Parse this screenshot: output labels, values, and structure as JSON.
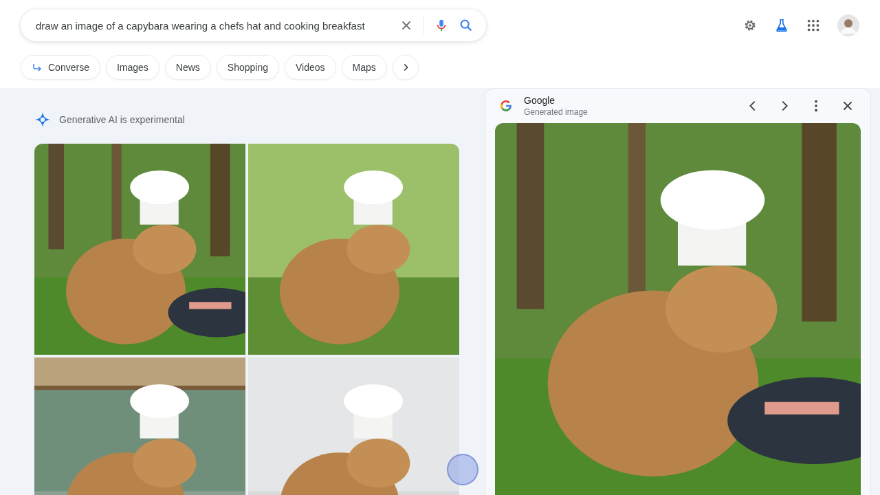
{
  "search": {
    "value": "draw an image of a capybara wearing a chefs hat and cooking breakfast"
  },
  "chips": [
    {
      "label": "Converse",
      "kind": "converse"
    },
    {
      "label": "Images",
      "kind": "plain"
    },
    {
      "label": "News",
      "kind": "plain"
    },
    {
      "label": "Shopping",
      "kind": "plain"
    },
    {
      "label": "Videos",
      "kind": "plain"
    },
    {
      "label": "Maps",
      "kind": "plain"
    }
  ],
  "ai_notice": {
    "text": "Generative AI is experimental"
  },
  "viewer": {
    "source": "Google",
    "subtitle": "Generated image"
  }
}
